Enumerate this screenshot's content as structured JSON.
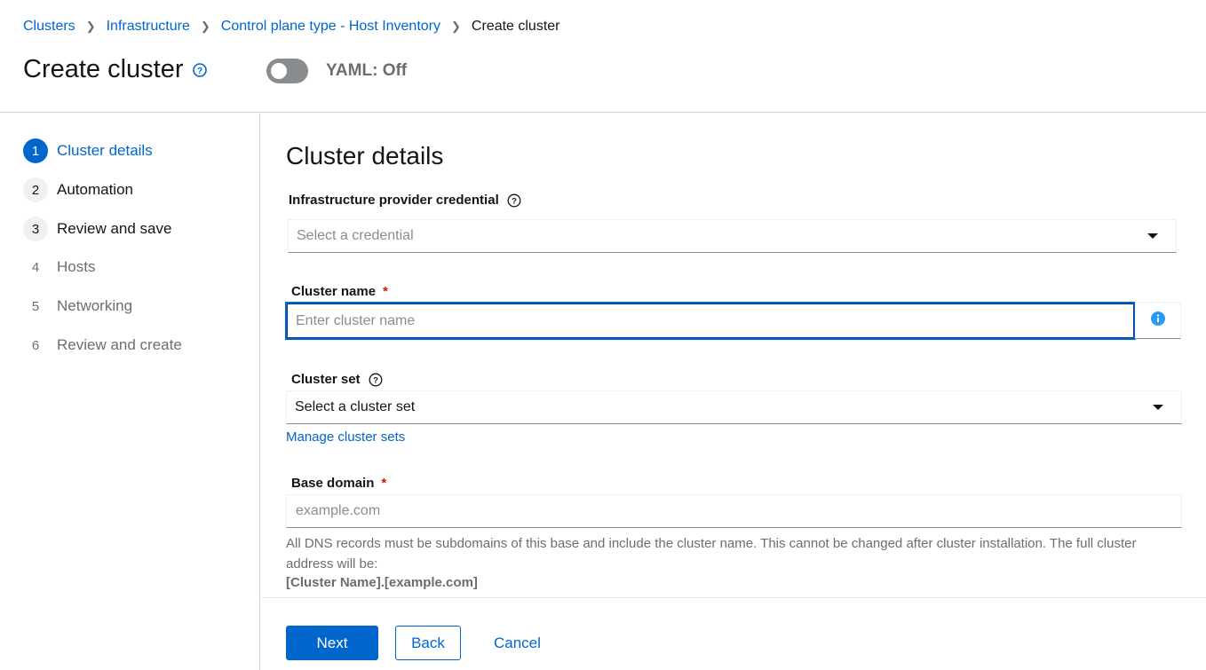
{
  "breadcrumb": {
    "items": [
      "Clusters",
      "Infrastructure",
      "Control plane type - Host Inventory"
    ],
    "current": "Create cluster"
  },
  "header": {
    "title": "Create cluster",
    "help_icon": "question-circle-icon",
    "yaml_toggle": {
      "label": "YAML: Off",
      "state": "off"
    }
  },
  "wizard": {
    "steps": [
      {
        "number": "1",
        "label": "Cluster details",
        "state": "active"
      },
      {
        "number": "2",
        "label": "Automation",
        "state": "visited"
      },
      {
        "number": "3",
        "label": "Review and save",
        "state": "visited"
      },
      {
        "number": "4",
        "label": "Hosts",
        "state": "disabled"
      },
      {
        "number": "5",
        "label": "Networking",
        "state": "disabled"
      },
      {
        "number": "6",
        "label": "Review and create",
        "state": "disabled"
      }
    ]
  },
  "form": {
    "section_title": "Cluster details",
    "credential": {
      "label": "Infrastructure provider credential",
      "placeholder": "Select a credential"
    },
    "cluster_name": {
      "label": "Cluster name",
      "required_mark": "*",
      "placeholder": "Enter cluster name",
      "value": "",
      "info_icon": "info-circle-icon"
    },
    "cluster_set": {
      "label": "Cluster set",
      "placeholder": "Select a cluster set",
      "manage_link": "Manage cluster sets"
    },
    "base_domain": {
      "label": "Base domain",
      "required_mark": "*",
      "placeholder": "example.com",
      "value": "",
      "helper_text": "All DNS records must be subdomains of this base and include the cluster name. This cannot be changed after cluster installation. The full cluster address will be:",
      "helper_example": "[Cluster Name].[example.com]"
    }
  },
  "footer": {
    "next_label": "Next",
    "back_label": "Back",
    "cancel_label": "Cancel"
  },
  "colors": {
    "accent": "#0066cc",
    "required": "#c9190b",
    "muted_text": "#6a6e73"
  }
}
